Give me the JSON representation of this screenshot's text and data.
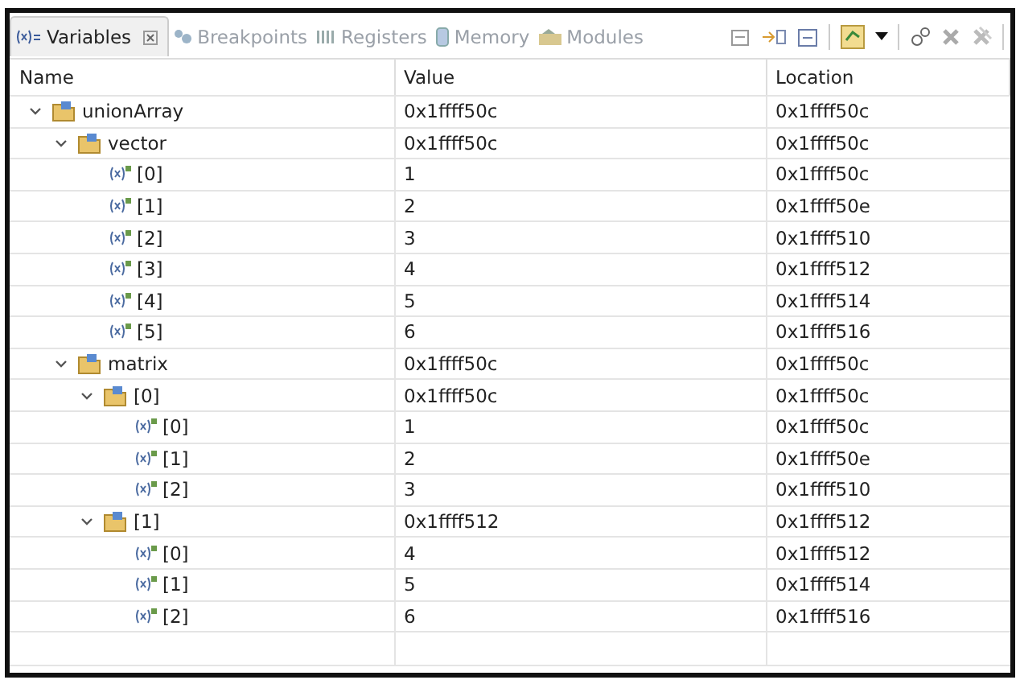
{
  "tabs": [
    {
      "label": "Variables",
      "selected": true
    },
    {
      "label": "Breakpoints",
      "selected": false
    },
    {
      "label": "Registers",
      "selected": false
    },
    {
      "label": "Memory",
      "selected": false
    },
    {
      "label": "Modules",
      "selected": false
    }
  ],
  "table": {
    "columns": [
      "Name",
      "Value",
      "Location"
    ],
    "rows": [
      {
        "kind": "struct",
        "name": "unionArray",
        "value": "0x1ffff50c",
        "location": "0x1ffff50c",
        "expanded": true,
        "children": [
          {
            "kind": "struct",
            "name": "vector",
            "value": "0x1ffff50c",
            "location": "0x1ffff50c",
            "expanded": true,
            "children": [
              {
                "kind": "element",
                "name": "[0]",
                "value": "1",
                "location": "0x1ffff50c"
              },
              {
                "kind": "element",
                "name": "[1]",
                "value": "2",
                "location": "0x1ffff50e"
              },
              {
                "kind": "element",
                "name": "[2]",
                "value": "3",
                "location": "0x1ffff510"
              },
              {
                "kind": "element",
                "name": "[3]",
                "value": "4",
                "location": "0x1ffff512"
              },
              {
                "kind": "element",
                "name": "[4]",
                "value": "5",
                "location": "0x1ffff514"
              },
              {
                "kind": "element",
                "name": "[5]",
                "value": "6",
                "location": "0x1ffff516"
              }
            ]
          },
          {
            "kind": "struct",
            "name": "matrix",
            "value": "0x1ffff50c",
            "location": "0x1ffff50c",
            "expanded": true,
            "children": [
              {
                "kind": "struct",
                "name": "[0]",
                "value": "0x1ffff50c",
                "location": "0x1ffff50c",
                "expanded": true,
                "children": [
                  {
                    "kind": "element",
                    "name": "[0]",
                    "value": "1",
                    "location": "0x1ffff50c"
                  },
                  {
                    "kind": "element",
                    "name": "[1]",
                    "value": "2",
                    "location": "0x1ffff50e"
                  },
                  {
                    "kind": "element",
                    "name": "[2]",
                    "value": "3",
                    "location": "0x1ffff510"
                  }
                ]
              },
              {
                "kind": "struct",
                "name": "[1]",
                "value": "0x1ffff512",
                "location": "0x1ffff512",
                "expanded": true,
                "children": [
                  {
                    "kind": "element",
                    "name": "[0]",
                    "value": "4",
                    "location": "0x1ffff512"
                  },
                  {
                    "kind": "element",
                    "name": "[1]",
                    "value": "5",
                    "location": "0x1ffff514"
                  },
                  {
                    "kind": "element",
                    "name": "[2]",
                    "value": "6",
                    "location": "0x1ffff516"
                  }
                ]
              }
            ]
          }
        ]
      }
    ]
  }
}
